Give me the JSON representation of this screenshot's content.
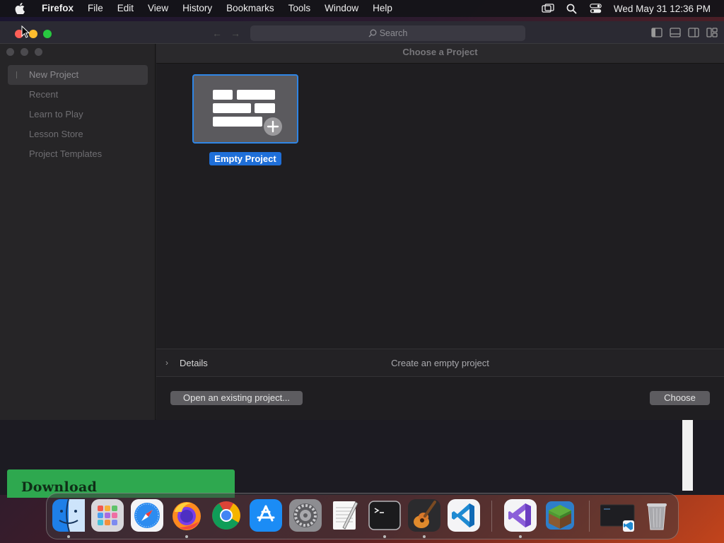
{
  "menubar": {
    "app_name": "Firefox",
    "items": [
      "File",
      "Edit",
      "View",
      "History",
      "Bookmarks",
      "Tools",
      "Window",
      "Help"
    ],
    "clock": "Wed May 31  12:36 PM",
    "status_icons": [
      "screen-mirroring-icon",
      "spotlight-search-icon",
      "control-center-icon"
    ]
  },
  "browser": {
    "search_placeholder": "Search",
    "download_label": "Download"
  },
  "dialog": {
    "title": "Choose a Project",
    "sidebar": [
      {
        "label": "New Project",
        "selected": true
      },
      {
        "label": "Recent",
        "selected": false
      },
      {
        "label": "Learn to Play",
        "selected": false
      },
      {
        "label": "Lesson Store",
        "selected": false
      },
      {
        "label": "Project Templates",
        "selected": false
      }
    ],
    "project": {
      "label": "Empty Project"
    },
    "details": {
      "label": "Details",
      "description": "Create an empty project"
    },
    "open_existing_label": "Open an existing project...",
    "choose_label": "Choose"
  },
  "dock": {
    "apps": [
      "Finder",
      "Launchpad",
      "Safari",
      "Firefox",
      "Chrome",
      "App Store",
      "System Preferences",
      "TextEdit",
      "Terminal",
      "GarageBand",
      "Visual Studio Code",
      "Visual Studio",
      "Minecraft",
      "VS Code Window",
      "Trash"
    ]
  },
  "colors": {
    "accent": "#1f6fd8",
    "close": "#ff5f57",
    "minimize": "#febc2e",
    "zoom": "#28c840"
  }
}
